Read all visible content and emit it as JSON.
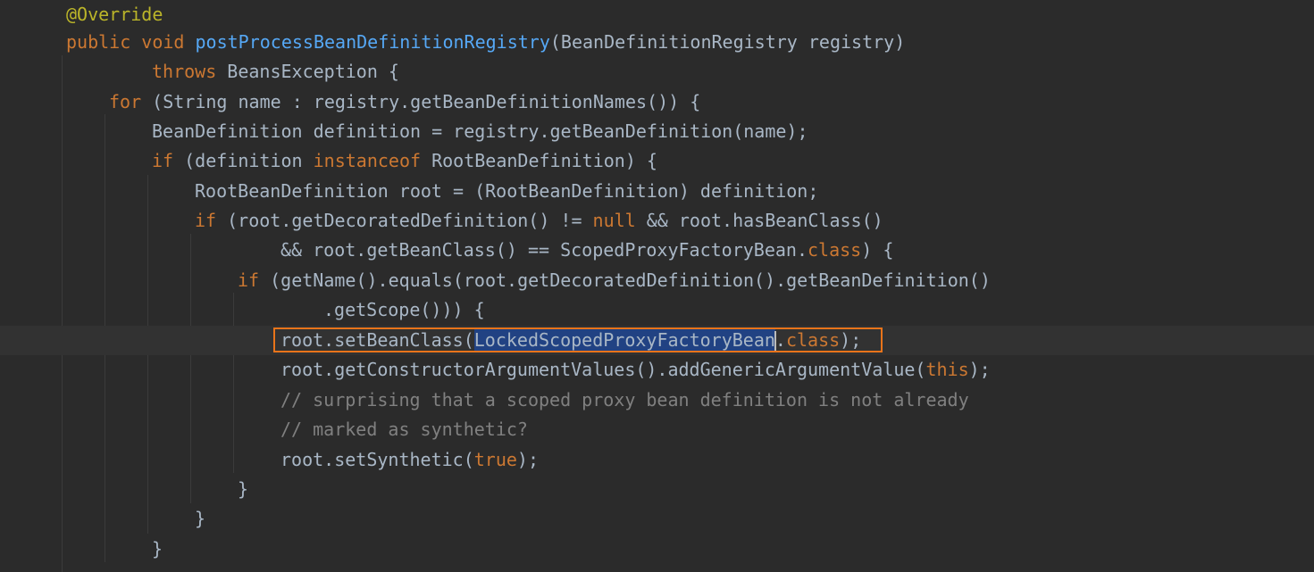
{
  "editor": {
    "lines": [
      {
        "tokens": [
          {
            "t": "@Override",
            "c": "an"
          }
        ]
      },
      {
        "tokens": [
          {
            "t": "public",
            "c": "kw"
          },
          {
            "t": " "
          },
          {
            "t": "void",
            "c": "kw"
          },
          {
            "t": " "
          },
          {
            "t": "postProcessBeanDefinitionRegistry",
            "c": "fn"
          },
          {
            "t": "(BeanDefinitionRegistry registry)"
          }
        ]
      },
      {
        "tokens": [
          {
            "t": "throws",
            "c": "kw"
          },
          {
            "t": " BeansException {"
          }
        ]
      },
      {
        "tokens": [
          {
            "t": "for",
            "c": "kw"
          },
          {
            "t": " (String name : registry.getBeanDefinitionNames()) {"
          }
        ]
      },
      {
        "tokens": [
          {
            "t": "BeanDefinition definition = registry.getBeanDefinition(name);"
          }
        ]
      },
      {
        "tokens": [
          {
            "t": "if",
            "c": "kw"
          },
          {
            "t": " (definition "
          },
          {
            "t": "instanceof",
            "c": "kw"
          },
          {
            "t": " RootBeanDefinition) {"
          }
        ]
      },
      {
        "tokens": [
          {
            "t": "RootBeanDefinition root = (RootBeanDefinition) definition;"
          }
        ]
      },
      {
        "tokens": [
          {
            "t": "if",
            "c": "kw"
          },
          {
            "t": " (root.getDecoratedDefinition() != "
          },
          {
            "t": "null",
            "c": "kw"
          },
          {
            "t": " && root.hasBeanClass()"
          }
        ]
      },
      {
        "tokens": [
          {
            "t": "&& root.getBeanClass() == ScopedProxyFactoryBean."
          },
          {
            "t": "class",
            "c": "kw"
          },
          {
            "t": ") {"
          }
        ]
      },
      {
        "tokens": [
          {
            "t": "if",
            "c": "kw"
          },
          {
            "t": " (getName().equals(root.getDecoratedDefinition().getBeanDefinition()"
          }
        ]
      },
      {
        "tokens": [
          {
            "t": ".getScope())) {"
          }
        ]
      },
      {
        "tokens": [
          {
            "t": "root.setBeanClass("
          },
          {
            "t": "LockedScopedProxyFactoryBean",
            "c": "sel"
          },
          {
            "t": "",
            "c": "caret"
          },
          {
            "t": "."
          },
          {
            "t": "class",
            "c": "kw"
          },
          {
            "t": ");"
          }
        ]
      },
      {
        "tokens": [
          {
            "t": "root.getConstructorArgumentValues().addGenericArgumentValue("
          },
          {
            "t": "this",
            "c": "kw"
          },
          {
            "t": ");"
          }
        ]
      },
      {
        "tokens": [
          {
            "t": "// surprising that a scoped proxy bean definition is not already",
            "c": "cm"
          }
        ]
      },
      {
        "tokens": [
          {
            "t": "// marked as synthetic?",
            "c": "cm"
          }
        ]
      },
      {
        "tokens": [
          {
            "t": "root.setSynthetic("
          },
          {
            "t": "true",
            "c": "kw"
          },
          {
            "t": ");"
          }
        ]
      },
      {
        "tokens": [
          {
            "t": "}"
          }
        ]
      },
      {
        "tokens": [
          {
            "t": "}"
          }
        ]
      },
      {
        "tokens": [
          {
            "t": "}"
          }
        ]
      }
    ]
  },
  "colors": {
    "background": "#2b2b2b",
    "default_text": "#a9b7c6",
    "keyword": "#cc7832",
    "annotation": "#bbb529",
    "method_declaration": "#56a8f5",
    "comment": "#808080",
    "selection": "#214283",
    "highlight_box": "#e8741a"
  }
}
